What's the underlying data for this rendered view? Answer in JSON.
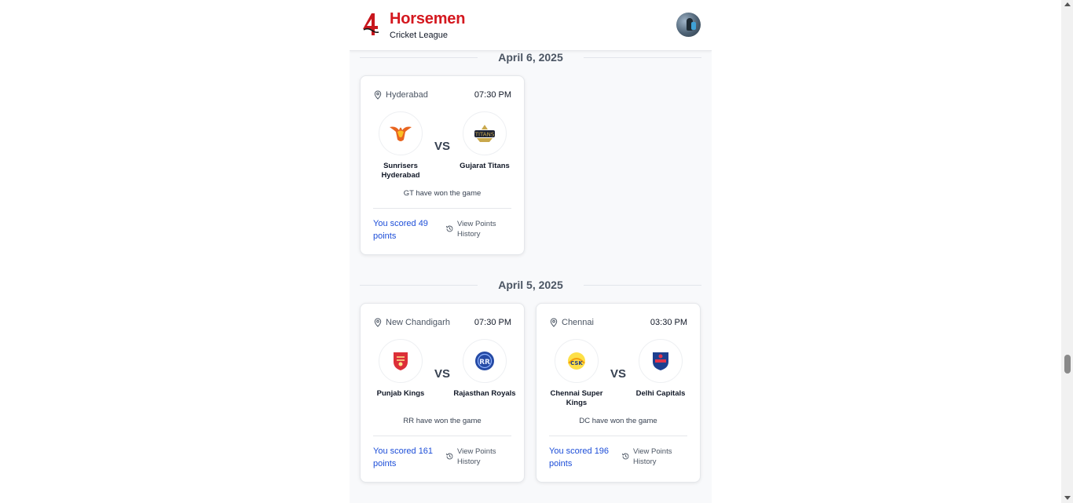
{
  "header": {
    "brand": "Horsemen",
    "subtitle": "Cricket League"
  },
  "labels": {
    "vs": "VS",
    "view_history": "View Points History"
  },
  "sections": [
    {
      "date": "April 6, 2025",
      "matches": [
        {
          "location": "Hyderabad",
          "time": "07:30 PM",
          "team1": {
            "name": "Sunrisers Hyderabad",
            "logo": "srh-logo"
          },
          "team2": {
            "name": "Gujarat Titans",
            "logo": "gt-logo"
          },
          "result": "GT have won the game",
          "score": "You scored 49 points"
        }
      ]
    },
    {
      "date": "April 5, 2025",
      "matches": [
        {
          "location": "New Chandigarh",
          "time": "07:30 PM",
          "team1": {
            "name": "Punjab Kings",
            "logo": "pbks-logo"
          },
          "team2": {
            "name": "Rajasthan Royals",
            "logo": "rr-logo"
          },
          "result": "RR have won the game",
          "score": "You scored 161 points"
        },
        {
          "location": "Chennai",
          "time": "03:30 PM",
          "team1": {
            "name": "Chennai Super Kings",
            "logo": "csk-logo"
          },
          "team2": {
            "name": "Delhi Capitals",
            "logo": "dc-logo"
          },
          "result": "DC have won the game",
          "score": "You scored 196 points"
        }
      ]
    }
  ],
  "icons": {
    "location": "map-pin-icon",
    "history": "history-icon"
  },
  "colors": {
    "brand": "#d4181f",
    "score": "#1d4ed8",
    "background": "#f8f9fb"
  }
}
